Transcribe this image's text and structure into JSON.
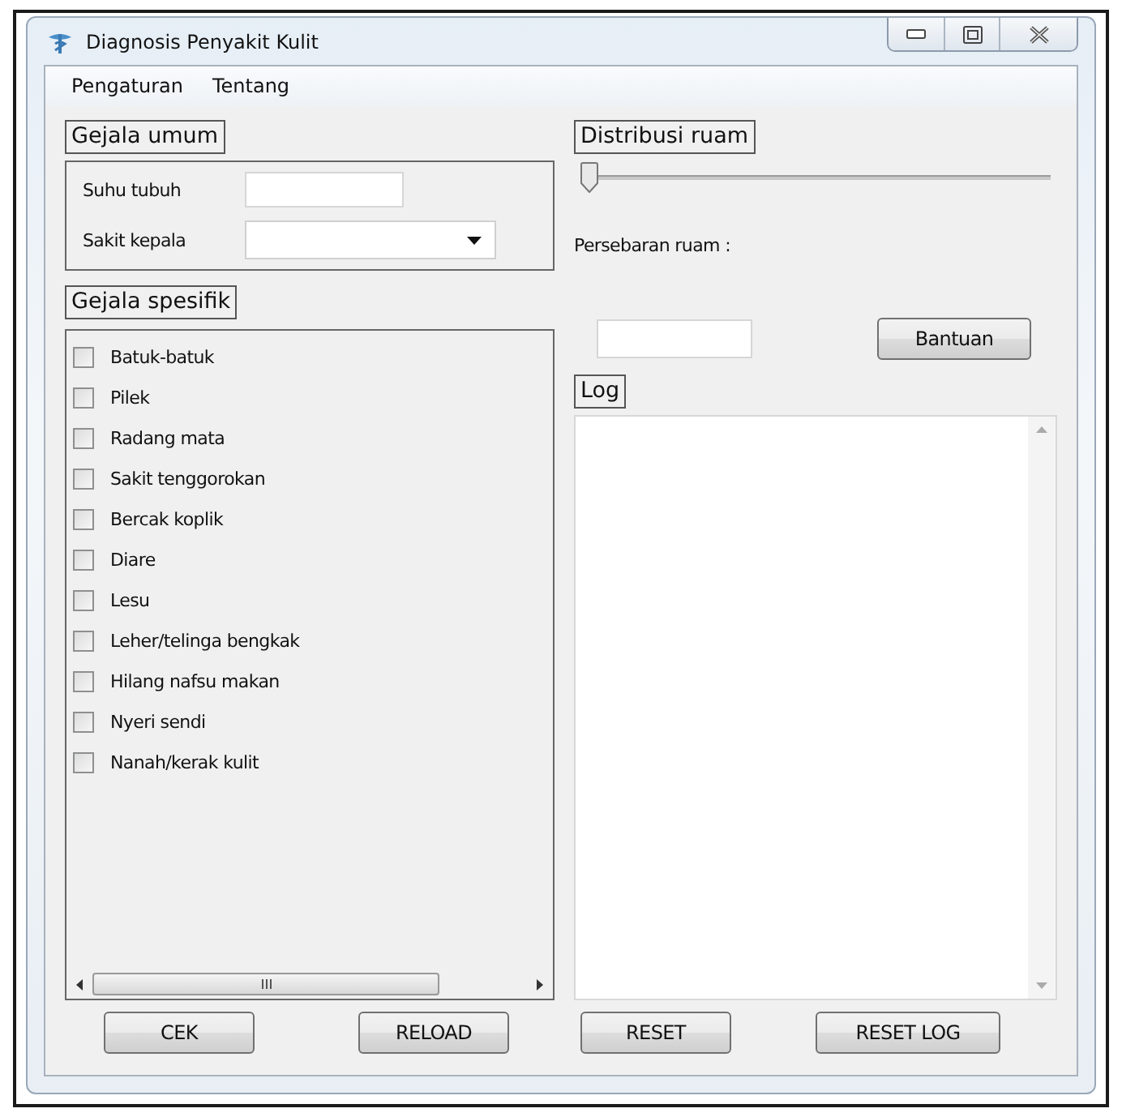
{
  "window": {
    "title": "Diagnosis Penyakit Kulit"
  },
  "menu": [
    "Pengaturan",
    "Tentang"
  ],
  "gejala_umum": {
    "title": "Gejala umum",
    "fields": [
      {
        "kind": "text",
        "label": "Suhu tubuh"
      },
      {
        "kind": "dropdown",
        "label": "Sakit kepala"
      }
    ]
  },
  "gejala_spesifik": {
    "title": "Gejala spesifik",
    "items": [
      {
        "label": "Batuk-batuk",
        "checked": false
      },
      {
        "label": "Pilek",
        "checked": false
      },
      {
        "label": "Radang mata",
        "checked": false
      },
      {
        "label": "Sakit tenggorokan",
        "checked": false
      },
      {
        "label": "Bercak koplik",
        "checked": false
      },
      {
        "label": "Diare",
        "checked": false
      },
      {
        "label": "Lesu",
        "checked": false
      },
      {
        "label": "Leher/telinga bengkak",
        "checked": false
      },
      {
        "label": "Hilang nafsu makan",
        "checked": false
      },
      {
        "label": "Nyeri sendi",
        "checked": false
      },
      {
        "label": "Nanah/kerak kulit",
        "checked": false
      }
    ]
  },
  "distribusi_ruam": {
    "title": "Distribusi ruam",
    "slider": {
      "level": 0
    },
    "label": "Persebaran ruam :",
    "help_button": "Bantuan"
  },
  "log": {
    "title": "Log"
  },
  "buttons": [
    "CEK",
    "RELOAD",
    "RESET",
    "RESET LOG"
  ]
}
